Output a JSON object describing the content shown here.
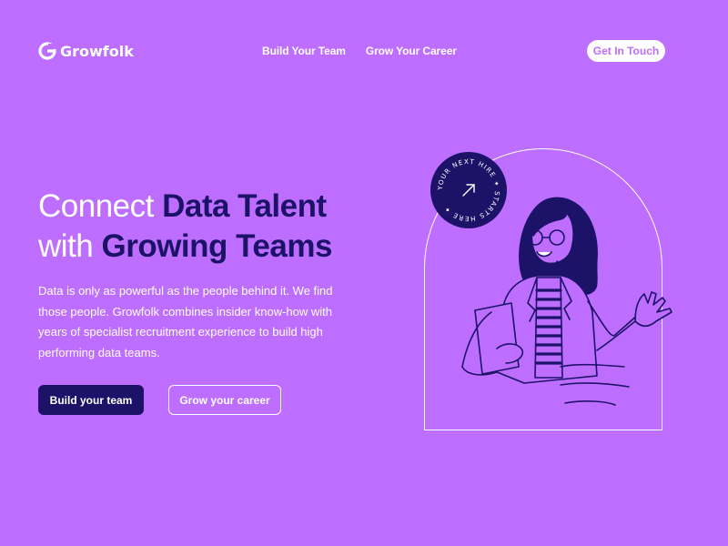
{
  "brand": {
    "name": "Growfolk",
    "logo_icon": "g-logo-icon"
  },
  "nav": {
    "items": [
      {
        "label": "Build Your Team"
      },
      {
        "label": "Grow Your Career"
      }
    ],
    "cta_label": "Get In Touch"
  },
  "hero": {
    "title_line1_plain": "Connect ",
    "title_line1_highlight": "Data Talent",
    "title_line2_plain": "with ",
    "title_line2_highlight": "Growing Teams",
    "description": "Data is only as powerful as the people behind it. We find those people. Growfolk combines insider know-how with years of specialist recruitment experience to build high performing data teams.",
    "primary_button": "Build your team",
    "secondary_button": "Grow your career"
  },
  "badge": {
    "ring_text": "YOUR NEXT HIRE ✦ STARTS HERE ✦",
    "icon": "arrow-up-right-icon"
  },
  "colors": {
    "background": "#bd6efe",
    "accent_dark": "#1c1268",
    "white": "#ffffff"
  }
}
